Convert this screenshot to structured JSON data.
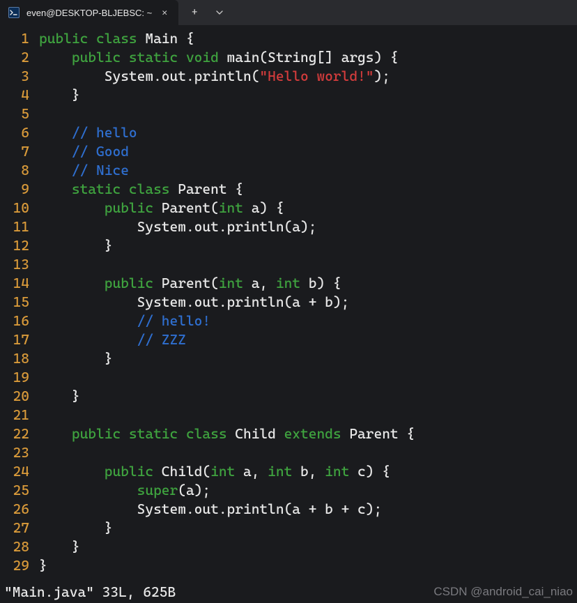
{
  "titlebar": {
    "tab_title": "even@DESKTOP-BLJEBSC: ~",
    "terminal_icon": "terminal-icon",
    "close_label": "✕",
    "new_tab_label": "+",
    "dropdown_label": "⌄"
  },
  "code": {
    "lines": [
      {
        "n": "1",
        "tokens": [
          [
            "kw-green",
            "public "
          ],
          [
            "kw-green",
            "class "
          ],
          [
            "white",
            "Main "
          ],
          [
            "punct",
            "{"
          ]
        ]
      },
      {
        "n": "2",
        "indent": "    ",
        "tokens": [
          [
            "kw-green",
            "public "
          ],
          [
            "kw-green",
            "static "
          ],
          [
            "kw-green",
            "void "
          ],
          [
            "white",
            "main(String[] args) "
          ],
          [
            "punct",
            "{"
          ]
        ]
      },
      {
        "n": "3",
        "indent": "        ",
        "tokens": [
          [
            "white",
            "System.out.println("
          ],
          [
            "str",
            "\"Hello world!\""
          ],
          [
            "white",
            ");"
          ]
        ]
      },
      {
        "n": "4",
        "indent": "    ",
        "tokens": [
          [
            "punct",
            "}"
          ]
        ]
      },
      {
        "n": "5",
        "indent": "",
        "tokens": []
      },
      {
        "n": "6",
        "indent": "    ",
        "tokens": [
          [
            "comment",
            "// hello"
          ]
        ]
      },
      {
        "n": "7",
        "indent": "    ",
        "tokens": [
          [
            "comment",
            "// Good"
          ]
        ]
      },
      {
        "n": "8",
        "indent": "    ",
        "tokens": [
          [
            "comment",
            "// Nice"
          ]
        ]
      },
      {
        "n": "9",
        "indent": "    ",
        "tokens": [
          [
            "kw-green",
            "static "
          ],
          [
            "kw-green",
            "class "
          ],
          [
            "white",
            "Parent "
          ],
          [
            "punct",
            "{"
          ]
        ]
      },
      {
        "n": "10",
        "indent": "        ",
        "tokens": [
          [
            "kw-green",
            "public "
          ],
          [
            "white",
            "Parent("
          ],
          [
            "type",
            "int"
          ],
          [
            "white",
            " a) "
          ],
          [
            "punct",
            "{"
          ]
        ]
      },
      {
        "n": "11",
        "indent": "            ",
        "tokens": [
          [
            "white",
            "System.out.println(a);"
          ]
        ]
      },
      {
        "n": "12",
        "indent": "        ",
        "tokens": [
          [
            "punct",
            "}"
          ]
        ]
      },
      {
        "n": "13",
        "indent": "",
        "tokens": []
      },
      {
        "n": "14",
        "indent": "        ",
        "tokens": [
          [
            "kw-green",
            "public "
          ],
          [
            "white",
            "Parent("
          ],
          [
            "type",
            "int"
          ],
          [
            "white",
            " a, "
          ],
          [
            "type",
            "int"
          ],
          [
            "white",
            " b) "
          ],
          [
            "punct",
            "{"
          ]
        ]
      },
      {
        "n": "15",
        "indent": "            ",
        "tokens": [
          [
            "white",
            "System.out.println(a + b);"
          ]
        ]
      },
      {
        "n": "16",
        "indent": "            ",
        "tokens": [
          [
            "comment",
            "// hello!"
          ]
        ]
      },
      {
        "n": "17",
        "indent": "            ",
        "tokens": [
          [
            "comment",
            "// ZZZ"
          ]
        ]
      },
      {
        "n": "18",
        "indent": "        ",
        "tokens": [
          [
            "punct",
            "}"
          ]
        ]
      },
      {
        "n": "19",
        "indent": "",
        "tokens": []
      },
      {
        "n": "20",
        "indent": "    ",
        "tokens": [
          [
            "punct",
            "}"
          ]
        ]
      },
      {
        "n": "21",
        "indent": "",
        "tokens": []
      },
      {
        "n": "22",
        "indent": "    ",
        "tokens": [
          [
            "kw-green",
            "public "
          ],
          [
            "kw-green",
            "static "
          ],
          [
            "kw-green",
            "class "
          ],
          [
            "white",
            "Child "
          ],
          [
            "kw-ext",
            "extends"
          ],
          [
            "white",
            " Parent "
          ],
          [
            "punct",
            "{"
          ]
        ]
      },
      {
        "n": "23",
        "indent": "",
        "tokens": []
      },
      {
        "n": "24",
        "indent": "        ",
        "tokens": [
          [
            "kw-green",
            "public "
          ],
          [
            "white",
            "Child("
          ],
          [
            "type",
            "int"
          ],
          [
            "white",
            " a, "
          ],
          [
            "type",
            "int"
          ],
          [
            "white",
            " b, "
          ],
          [
            "type",
            "int"
          ],
          [
            "white",
            " c) "
          ],
          [
            "punct",
            "{"
          ]
        ]
      },
      {
        "n": "25",
        "indent": "            ",
        "tokens": [
          [
            "kw-green",
            "super"
          ],
          [
            "white",
            "(a);"
          ]
        ]
      },
      {
        "n": "26",
        "indent": "            ",
        "tokens": [
          [
            "white",
            "System.out.println(a + b + c);"
          ]
        ]
      },
      {
        "n": "27",
        "indent": "        ",
        "tokens": [
          [
            "punct",
            "}"
          ]
        ]
      },
      {
        "n": "28",
        "indent": "    ",
        "tokens": [
          [
            "punct",
            "}"
          ]
        ]
      },
      {
        "n": "29",
        "indent": "",
        "tokens": [
          [
            "punct",
            "}"
          ]
        ]
      }
    ]
  },
  "status": {
    "text": "\"Main.java\" 33L, 625B"
  },
  "watermark": "CSDN @android_cai_niao"
}
